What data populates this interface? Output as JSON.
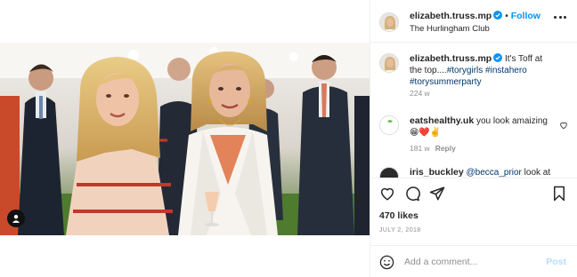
{
  "header": {
    "username": "elizabeth.truss.mp",
    "separator": "•",
    "follow_label": "Follow",
    "location": "The Hurlingham Club",
    "verified_color": "#0095f6"
  },
  "comments": [
    {
      "username": "elizabeth.truss.mp",
      "text": "It's Toff at the top....",
      "hashtags": "#torygirls #instahero #torysummerparty",
      "age": "224 w"
    },
    {
      "username": "eatshealthy.uk",
      "text": "you look amaizing",
      "emojis": "😁❤️✌️",
      "age": "181 w",
      "reply_label": "Reply",
      "avatar_text": "Eats Healthy"
    },
    {
      "username": "iris_buckley",
      "mention": "@becca_prior",
      "text": "look at"
    }
  ],
  "actions": {
    "icons": [
      "heart-icon",
      "comment-icon",
      "share-icon",
      "bookmark-icon"
    ],
    "likes": "470 likes",
    "date": "JULY 2, 2018"
  },
  "add_comment": {
    "placeholder": "Add a comment...",
    "post_label": "Post"
  },
  "colors": {
    "accent": "#0095f6",
    "text": "#262626",
    "muted": "#8e8e8e",
    "hashtag": "#00376b",
    "post_disabled": "#b2dffc"
  }
}
